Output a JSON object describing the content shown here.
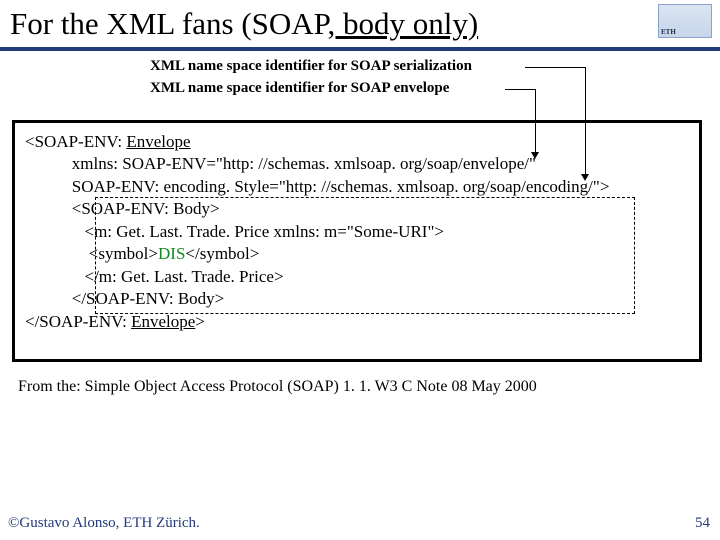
{
  "title_parts": {
    "prefix": "For the XML fans (SOAP",
    "suffix": ", body only)"
  },
  "logo_text": "ETH",
  "labels": {
    "serialization": "XML name space identifier for SOAP serialization",
    "envelope": "XML name space identifier for SOAP envelope"
  },
  "code": {
    "l1a": "<SOAP-ENV: ",
    "l1b": "Envelope",
    "l2": "           xmlns: SOAP-ENV=\"http: //schemas. xmlsoap. org/soap/envelope/\"",
    "l3": "           SOAP-ENV: encoding. Style=\"http: //schemas. xmlsoap. org/soap/encoding/\">",
    "l4": "           <SOAP-ENV: Body>",
    "l5": "              <m: Get. Last. Trade. Price xmlns: m=\"Some-URI\">",
    "l6a": "               <symbol>",
    "l6b": "DIS",
    "l6c": "</symbol>",
    "l7": "              </m: Get. Last. Trade. Price>",
    "l8": "           </SOAP-ENV: Body>",
    "l9a": "</SOAP-ENV: ",
    "l9b": "Envelope",
    "l9c": ">"
  },
  "source": "From the: Simple Object Access Protocol (SOAP) 1. 1. W3 C Note 08 May 2000",
  "copyright": "©Gustavo Alonso,  ETH Zürich.",
  "page_number": "54"
}
